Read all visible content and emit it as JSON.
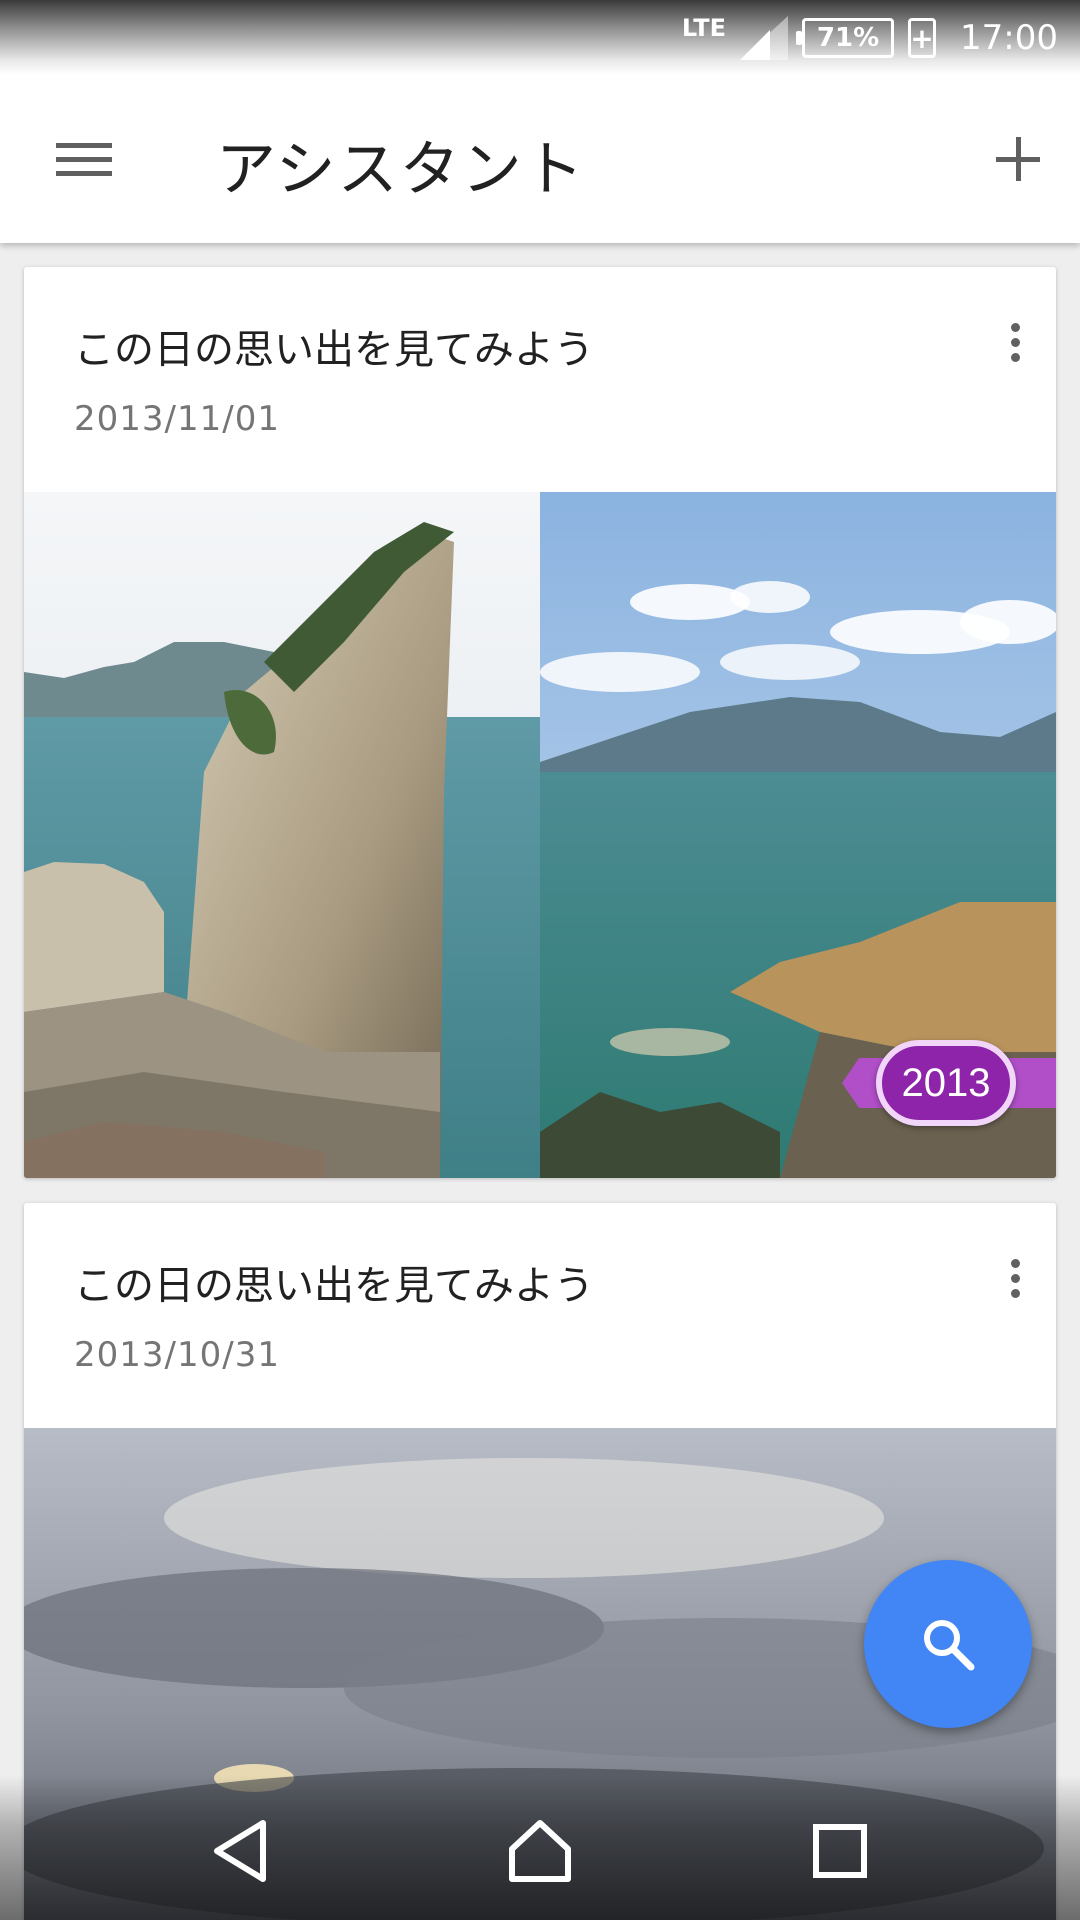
{
  "status_bar": {
    "network": "LTE",
    "battery": "71%",
    "time": "17:00"
  },
  "app_bar": {
    "title": "アシスタント"
  },
  "cards": [
    {
      "title": "この日の思い出を見てみよう",
      "date": "2013/11/01",
      "badge_year": "2013"
    },
    {
      "title": "この日の思い出を見てみよう",
      "date": "2013/10/31"
    }
  ],
  "colors": {
    "fab": "#4285f4",
    "badge": "#8e24aa",
    "ribbon": "#b04fc8"
  },
  "icons": {
    "menu": "menu-icon",
    "add": "add-icon",
    "overflow": "more-vert-icon",
    "search": "search-icon",
    "back": "back-icon",
    "home": "home-icon",
    "recent": "recent-apps-icon"
  }
}
